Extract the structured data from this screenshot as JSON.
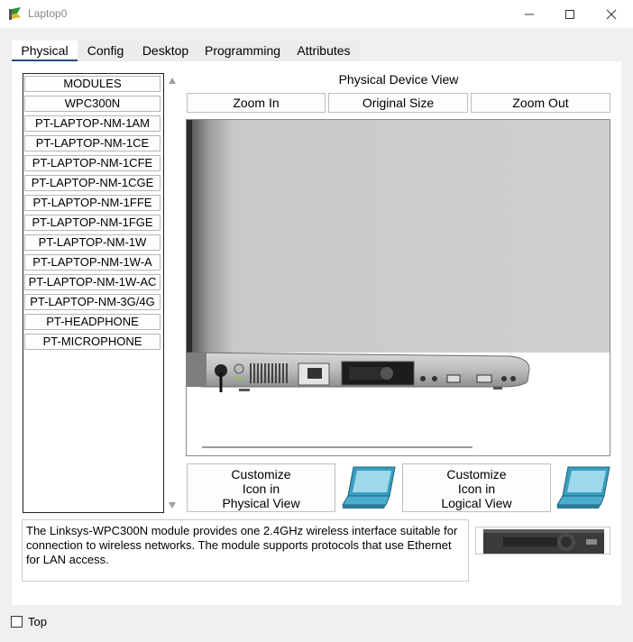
{
  "window": {
    "title": "Laptop0",
    "controls": [
      "minimize",
      "maximize",
      "close"
    ]
  },
  "tabs": [
    {
      "label": "Physical",
      "active": true
    },
    {
      "label": "Config",
      "active": false
    },
    {
      "label": "Desktop",
      "active": false
    },
    {
      "label": "Programming",
      "active": false
    },
    {
      "label": "Attributes",
      "active": false
    }
  ],
  "modules": [
    "MODULES",
    "WPC300N",
    "PT-LAPTOP-NM-1AM",
    "PT-LAPTOP-NM-1CE",
    "PT-LAPTOP-NM-1CFE",
    "PT-LAPTOP-NM-1CGE",
    "PT-LAPTOP-NM-1FFE",
    "PT-LAPTOP-NM-1FGE",
    "PT-LAPTOP-NM-1W",
    "PT-LAPTOP-NM-1W-A",
    "PT-LAPTOP-NM-1W-AC",
    "PT-LAPTOP-NM-3G/4G",
    "PT-HEADPHONE",
    "PT-MICROPHONE"
  ],
  "view": {
    "title": "Physical Device View",
    "zoom_in": "Zoom In",
    "original_size": "Original Size",
    "zoom_out": "Zoom Out"
  },
  "customize": {
    "physical": [
      "Customize",
      "Icon in",
      "Physical View"
    ],
    "logical": [
      "Customize",
      "Icon in",
      "Logical View"
    ]
  },
  "description": "The Linksys-WPC300N module provides one 2.4GHz wireless interface suitable for connection to wireless networks. The module supports protocols that use Ethernet for LAN access.",
  "footer": {
    "top_label": "Top",
    "top_checked": false
  },
  "colors": {
    "tab_underline": "#1f4b80",
    "laptop_blue": "#3a9ec2"
  }
}
